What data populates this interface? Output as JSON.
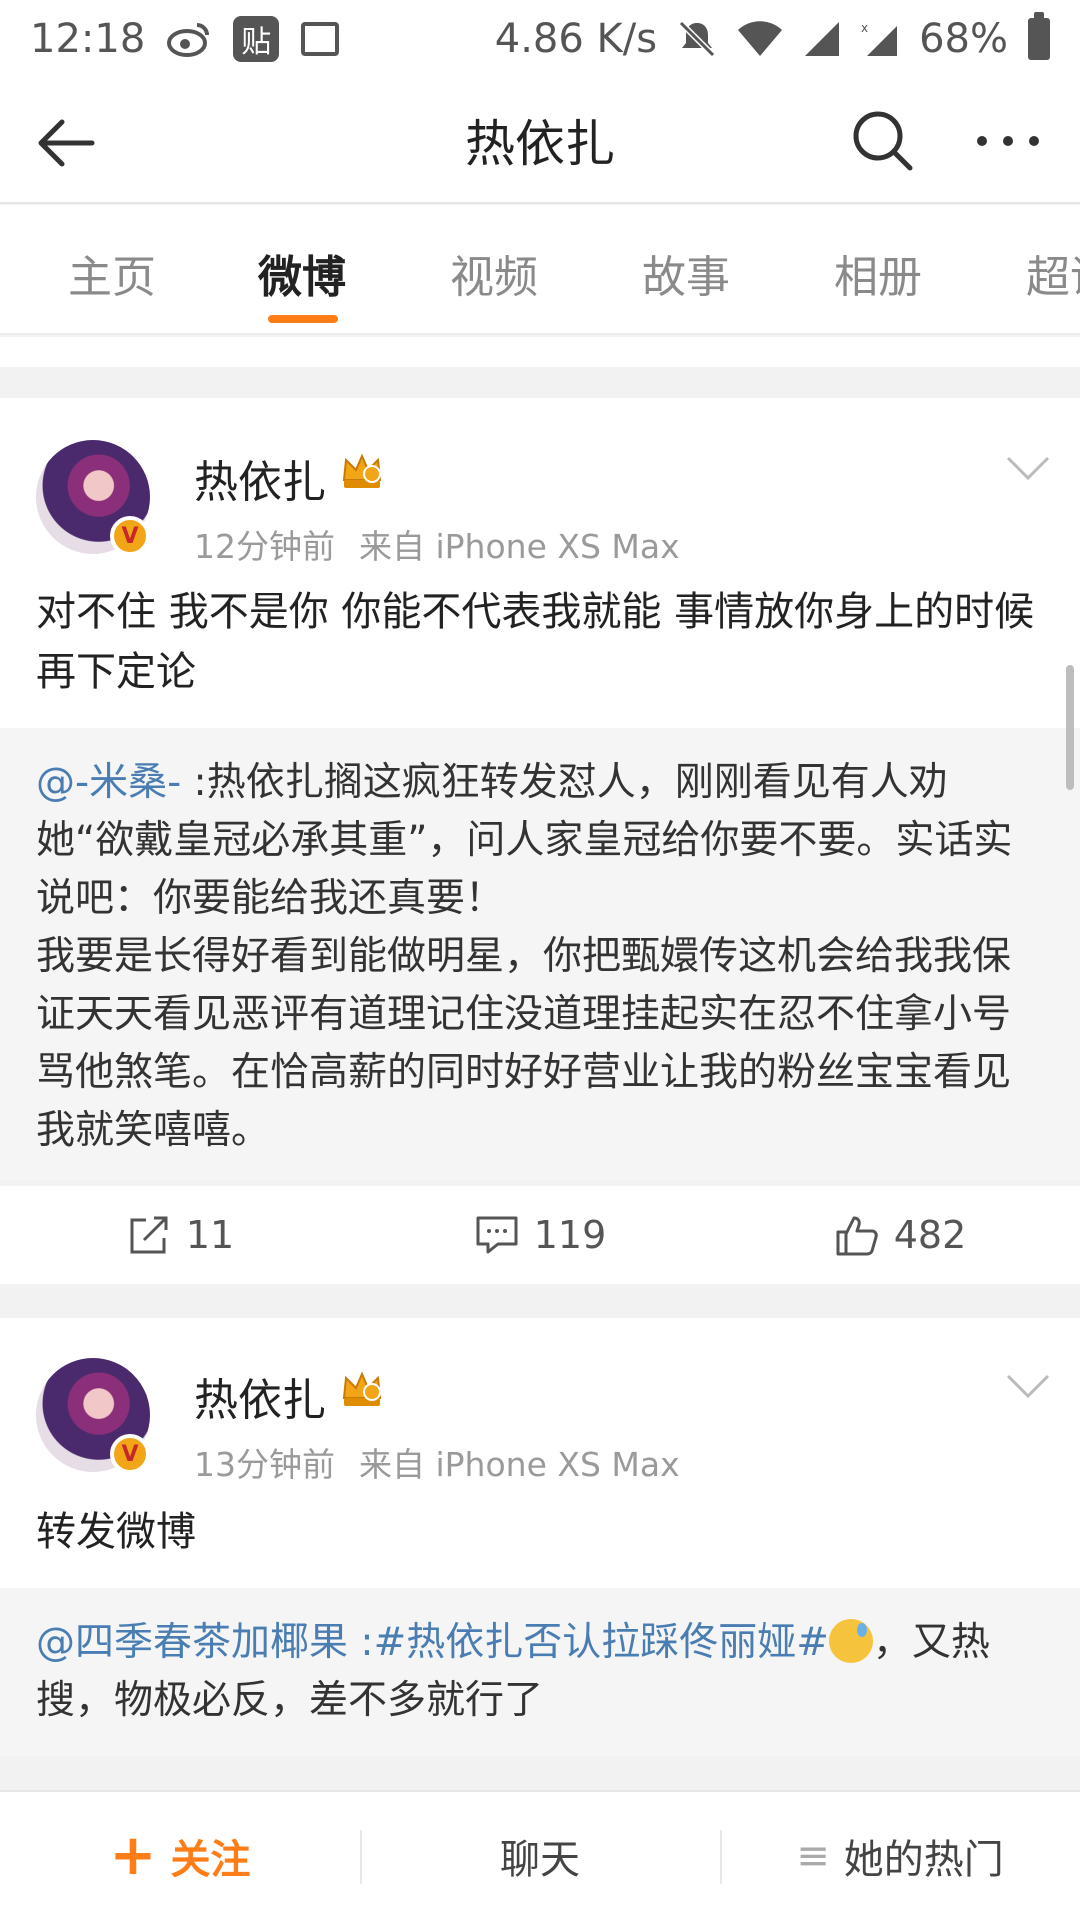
{
  "status_bar": {
    "time": "12:18",
    "tie_glyph": "贴",
    "network_speed": "4.86 K/s",
    "battery": "68%",
    "icons": [
      "weibo-icon",
      "tieba-icon",
      "image-icon",
      "mute-icon",
      "wifi-icon",
      "signal-icon",
      "signal-x-icon",
      "battery-icon"
    ]
  },
  "nav": {
    "title": "热依扎"
  },
  "tabs": [
    {
      "label": "主页",
      "active": false
    },
    {
      "label": "微博",
      "active": true
    },
    {
      "label": "视频",
      "active": false
    },
    {
      "label": "故事",
      "active": false
    },
    {
      "label": "相册",
      "active": false
    },
    {
      "label": "超话",
      "active": false
    }
  ],
  "posts": [
    {
      "author": "热依扎",
      "verified_glyph": "V",
      "time": "12分钟前",
      "source": "来自 iPhone XS Max",
      "text": "对不住 我不是你 你能不代表我就能 事情放你身上的时候再下定论",
      "repost": {
        "mention": "@-米桑-",
        "text": " :热依扎搁这疯狂转发怼人，刚刚看见有人劝她“欲戴皇冠必承其重”，问人家皇冠给你要不要。实话实说吧：你要能给我还真要！",
        "text2": "我要是长得好看到能做明星，你把甄嬛传这机会给我我保证天天看见恶评有道理记住没道理挂起实在忍不住拿小号骂他煞笔。在恰高薪的同时好好营业让我的粉丝宝宝看见我就笑嘻嘻。"
      },
      "actions": {
        "repost": "11",
        "comment": "119",
        "like": "482"
      }
    },
    {
      "author": "热依扎",
      "verified_glyph": "V",
      "time": "13分钟前",
      "source": "来自 iPhone XS Max",
      "text": "转发微博",
      "repost": {
        "mention": "@四季春茶加椰果",
        "colon": " :",
        "hashtag": "#热依扎否认拉踩佟丽娅#",
        "text": "，又热搜，物极必反，差不多就行了"
      }
    }
  ],
  "bottom_bar": {
    "follow_plus": "+",
    "follow": "关注",
    "chat": "聊天",
    "hot_glyph": "≡",
    "hot": "她的热门"
  },
  "colors": {
    "accent": "#ff7d16",
    "link": "#4a7db2",
    "badge": "#f2a516"
  }
}
